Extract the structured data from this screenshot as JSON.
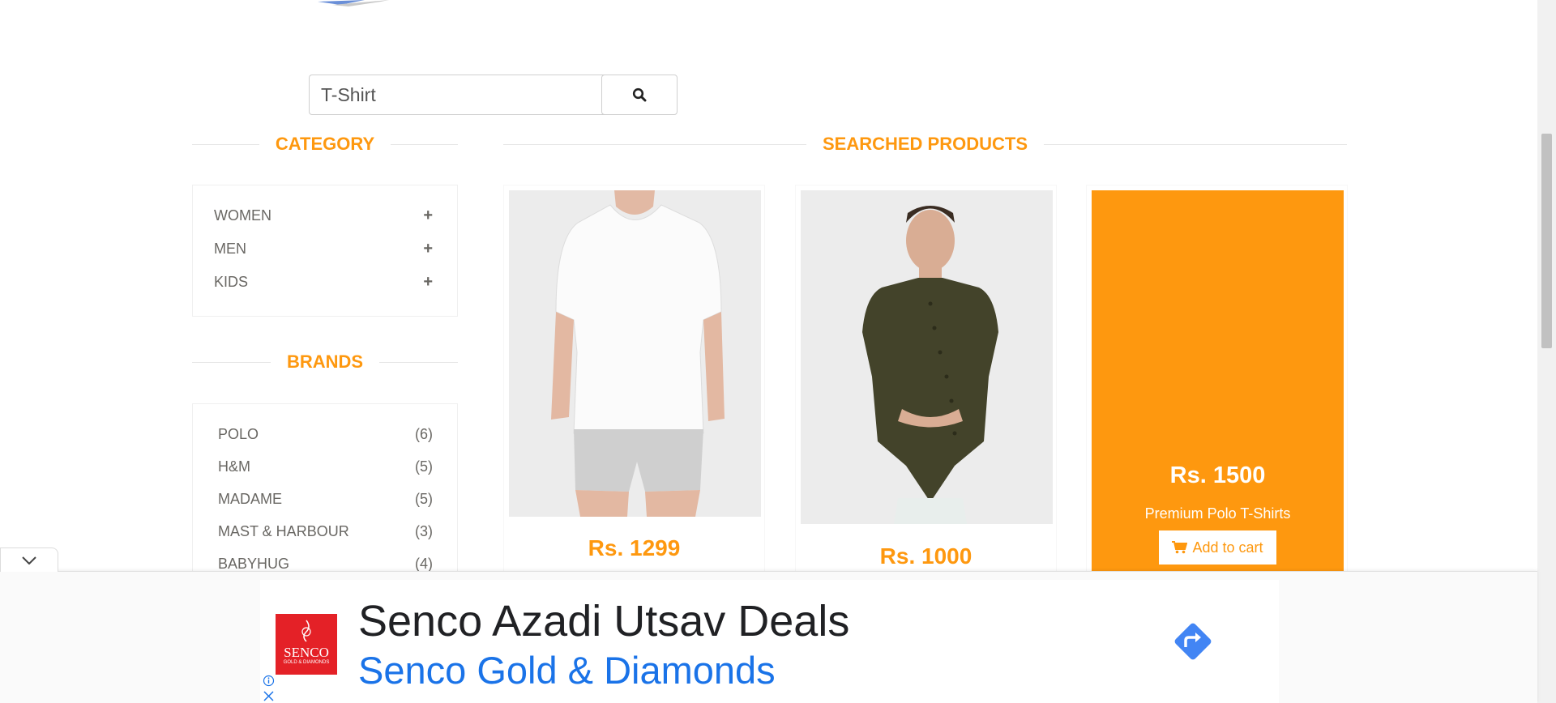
{
  "search": {
    "value": "T-Shirt",
    "button_icon": "search-icon"
  },
  "sidebar": {
    "category_title": "CATEGORY",
    "categories": [
      {
        "label": "WOMEN",
        "icon": "plus-icon"
      },
      {
        "label": "MEN",
        "icon": "plus-icon"
      },
      {
        "label": "KIDS",
        "icon": "plus-icon"
      }
    ],
    "brands_title": "BRANDS",
    "brands": [
      {
        "label": "POLO",
        "count": "(6)"
      },
      {
        "label": "H&M",
        "count": "(5)"
      },
      {
        "label": "MADAME",
        "count": "(5)"
      },
      {
        "label": "MAST & HARBOUR",
        "count": "(3)"
      },
      {
        "label": "BABYHUG",
        "count": "(4)"
      }
    ]
  },
  "products": {
    "title": "SEARCHED PRODUCTS",
    "items": [
      {
        "price": "Rs. 1299",
        "image": "white-v-neck-tshirt"
      },
      {
        "price": "Rs. 1000",
        "image": "olive-asymmetric-shirt"
      },
      {
        "price": "Rs. 1500",
        "name": "Premium Polo T-Shirts",
        "cart_label": "Add to cart"
      }
    ]
  },
  "ad": {
    "headline": "Senco Azadi Utsav Deals",
    "subline": "Senco Gold & Diamonds",
    "logo_text": "SENCO",
    "logo_subtext": "GOLD & DIAMONDS"
  },
  "colors": {
    "accent": "#fe980f",
    "ad_link": "#1a73e8",
    "ad_brand": "#e42127"
  }
}
